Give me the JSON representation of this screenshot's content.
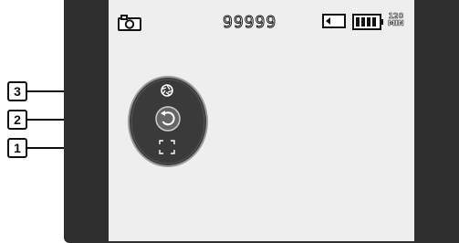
{
  "status_bar": {
    "mode_icon": "camera-icon",
    "remaining_shots": "99999",
    "storage_icon": "memory-card-icon",
    "battery_icon": "battery-full-icon",
    "remaining_time_value": "120",
    "remaining_time_unit": "MIN"
  },
  "controls": {
    "top_icon": "anti-shake-icon",
    "middle_icon": "return-icon",
    "bottom_icon": "focus-frame-icon"
  },
  "callouts": [
    {
      "label": "3"
    },
    {
      "label": "2"
    },
    {
      "label": "1"
    }
  ]
}
